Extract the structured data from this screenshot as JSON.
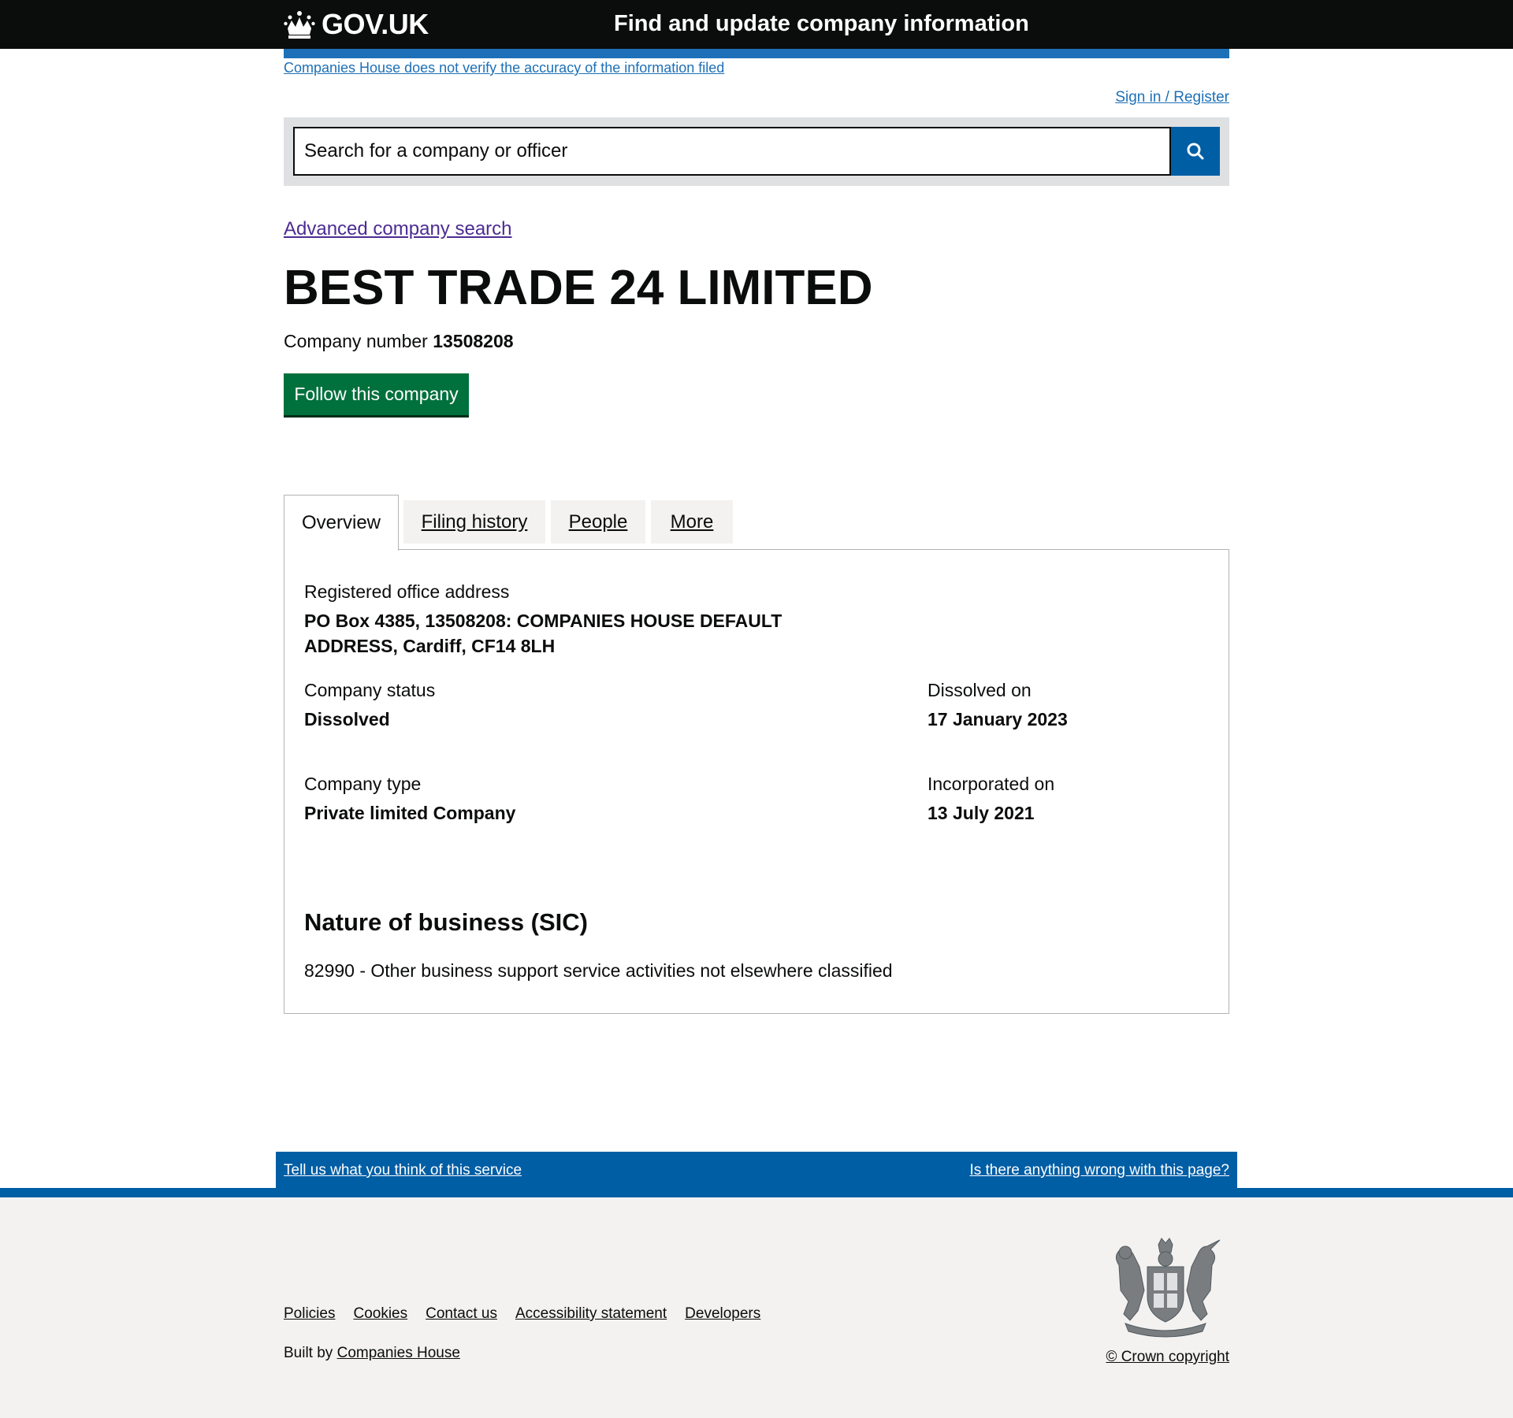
{
  "header": {
    "logo_text": "GOV.UK",
    "service_name": "Find and update company information"
  },
  "banner": {
    "notice": "Companies House does not verify the accuracy of the information filed",
    "sign_in": "Sign in / Register"
  },
  "search": {
    "placeholder": "Search for a company or officer",
    "button_icon": "search-icon"
  },
  "advanced_search": "Advanced company search",
  "company": {
    "name": "BEST TRADE 24 LIMITED",
    "number_label": "Company number",
    "number": "13508208",
    "follow_button": "Follow this company"
  },
  "tabs": [
    {
      "label": "Overview",
      "active": true
    },
    {
      "label": "Filing history",
      "active": false
    },
    {
      "label": "People",
      "active": false
    },
    {
      "label": "More",
      "active": false
    }
  ],
  "overview": {
    "address_label": "Registered office address",
    "address_line1": "PO Box 4385, 13508208: COMPANIES HOUSE DEFAULT",
    "address_line2": "ADDRESS, Cardiff, CF14 8LH",
    "status_label": "Company status",
    "status": "Dissolved",
    "dissolved_label": "Dissolved on",
    "dissolved_date": "17 January 2023",
    "type_label": "Company type",
    "type": "Private limited Company",
    "incorporated_label": "Incorporated on",
    "incorporated_date": "13 July 2021",
    "sic_heading": "Nature of business (SIC)",
    "sic_item": "82990 - Other business support service activities not elsewhere classified"
  },
  "feedback": {
    "left": "Tell us what you think of this service",
    "right": "Is there anything wrong with this page?"
  },
  "footer": {
    "links": [
      "Policies",
      "Cookies",
      "Contact us",
      "Accessibility statement",
      "Developers"
    ],
    "built_by_prefix": "Built by",
    "built_by_link": "Companies House",
    "copyright": "© Crown copyright"
  },
  "colors": {
    "header_bg": "#0b0c0c",
    "brand_blue": "#1d70b8",
    "footer_blue": "#005ea5",
    "follow_green": "#00703c",
    "visited_link": "#4c2c92",
    "footer_bg": "#f3f2f1"
  }
}
